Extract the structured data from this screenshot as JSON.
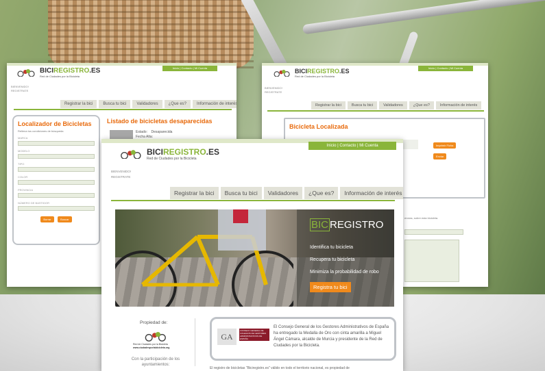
{
  "window1": {
    "brand_a": "BICI",
    "brand_b": "REGISTRO",
    "brand_c": ".ES",
    "subtitle": "Red de Ciudades por la Bicicleta",
    "toplinks": "Inicio  |  Contacto  |  Mi Cuenta",
    "small_1": "BIENVENIDO!",
    "small_2": "REGISTRATE",
    "nav": [
      "Registrar la bici",
      "Busca tu bici",
      "Validadores",
      "¿Que es?",
      "Información de interés"
    ],
    "locator_title": "Localizador de Bicicletas",
    "locator_sub": "Rellena tus condiciones de búsqueda",
    "fields": [
      "MARCA",
      "MODELO",
      "TIPO",
      "COLOR",
      "PROVINCIA",
      "NÚMERO DE BASTIDOR"
    ],
    "btn_clear": "Borrar",
    "btn_search": "Buscar",
    "list_title": "Listado de bicicletas desaparecidas",
    "status_label": "Estado:",
    "status_value": "Desaparecida",
    "date_label": "Fecha Alta:"
  },
  "window2": {
    "brand_a": "BICI",
    "brand_b": "REGISTRO",
    "brand_c": ".ES",
    "subtitle": "Red de Ciudades por la Bicicleta",
    "toplinks": "Inicio  |  Contacto  |  Mi Cuenta",
    "small_1": "BIENVENIDO!",
    "small_2": "REGISTRATE",
    "nav": [
      "Registrar la bici",
      "Busca tu bici",
      "Validadores",
      "¿Que es?",
      "Información de interés"
    ],
    "found_title": "Bicicleta Localizada",
    "btn_print": "Imprimir Ficha",
    "btn_send": "Enviar",
    "info_text": "encias, sobre esta bicicleta."
  },
  "window3": {
    "brand_a": "BICI",
    "brand_b": "REGISTRO",
    "brand_c": ".ES",
    "subtitle": "Red de Ciudades por la Bicicleta",
    "toplinks": "Inicio  |  Contacto  |  Mi Cuenta",
    "small_1": "BIENVENIDO!",
    "small_2": "REGISTRATE",
    "nav": [
      "Registrar la bici",
      "Busca tu bici",
      "Validadores",
      "¿Que es?",
      "Información de interés"
    ],
    "hero_logo_a": "BIC",
    "hero_logo_b": "REGISTRO",
    "hero_lines": [
      "Identifica tu bicicleta",
      "Recupera tu bicicleta",
      "Minimiza la probabilidad de robo"
    ],
    "hero_button": "Registra tu bici",
    "owned_by": "Propiedad de:",
    "owner_name": "Red de Ciudades por la Bicicleta",
    "owner_url": "www.ciudadesporlabicicleta.org",
    "participation": "Con la participación de los ayuntamientos:",
    "news_logo": "GA",
    "news_logo_text": "CONSEJO GENERAL DE COLEGIOS DE GESTORES ADMINISTRATIVOS DE ESPAÑA",
    "news_text": "El Consejo General de los Gestores Administrativos de España ha entregado la Medalla de Oro con cinta amarilla a Miguel Ángel Cámara, alcalde de Murcia y presidente de la Red de Ciudades por la Bicicleta.",
    "footer_text": "El registro de bicicletas \"Biciregistro.es\" válido en todo el territorio nacional, es propiedad de"
  },
  "colors": {
    "green": "#8ab53a",
    "orange": "#f08a1c",
    "title_orange": "#e86a0c"
  }
}
